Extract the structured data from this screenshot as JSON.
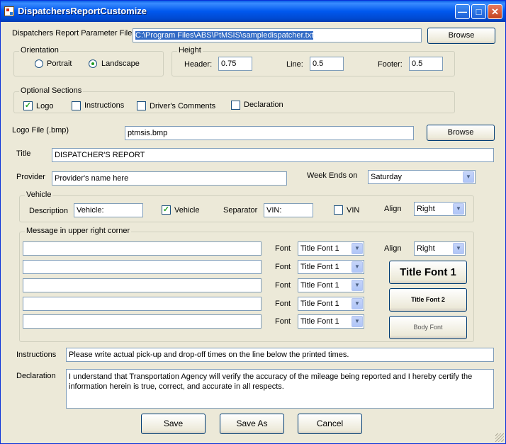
{
  "window": {
    "title": "DispatchersReportCustomize"
  },
  "param_file": {
    "label": "Dispatchers Report Parameter File",
    "value": "C:\\Program Files\\ABS\\PtMSIS\\sampledispatcher.txt",
    "browse": "Browse"
  },
  "orientation": {
    "title": "Orientation",
    "portrait": "Portrait",
    "landscape": "Landscape",
    "selected": "Landscape"
  },
  "height": {
    "title": "Height",
    "header_label": "Header:",
    "header_value": "0.75",
    "line_label": "Line:",
    "line_value": "0.5",
    "footer_label": "Footer:",
    "footer_value": "0.5"
  },
  "optional": {
    "title": "Optional Sections",
    "logo": "Logo",
    "logo_checked": true,
    "instructions": "Instructions",
    "drivers_comments": "Driver's Comments",
    "declaration": "Declaration"
  },
  "logo_file": {
    "label": "Logo File (.bmp)",
    "value": "ptmsis.bmp",
    "browse": "Browse"
  },
  "title_field": {
    "label": "Title",
    "value": "DISPATCHER'S REPORT"
  },
  "provider": {
    "label": "Provider",
    "value": "Provider's name here"
  },
  "week_ends": {
    "label": "Week Ends on",
    "value": "Saturday"
  },
  "vehicle": {
    "title": "Vehicle",
    "description_label": "Description",
    "description_value": "Vehicle:",
    "vehicle_check": "Vehicle",
    "separator_label": "Separator",
    "separator_value": "VIN:",
    "vin_check": "VIN",
    "align_label": "Align",
    "align_value": "Right"
  },
  "message": {
    "title": "Message in upper right corner",
    "font_label": "Font",
    "rows": [
      {
        "text": "",
        "font": "Title Font 1"
      },
      {
        "text": "",
        "font": "Title Font 1"
      },
      {
        "text": "",
        "font": "Title Font 1"
      },
      {
        "text": "",
        "font": "Title Font 1"
      },
      {
        "text": "",
        "font": "Title Font 1"
      }
    ],
    "align_label": "Align",
    "align_value": "Right",
    "font_buttons": [
      "Title Font 1",
      "Title Font 2",
      "Body Font"
    ]
  },
  "instructions": {
    "label": "Instructions",
    "value": "Please write actual pick-up and drop-off times on the line below the printed times."
  },
  "declaration": {
    "label": "Declaration",
    "value": "I understand that Transportation Agency will verify the accuracy of the mileage being reported and I hereby certify the information herein is true, correct, and accurate in all respects."
  },
  "buttons": {
    "save": "Save",
    "save_as": "Save As",
    "cancel": "Cancel"
  }
}
